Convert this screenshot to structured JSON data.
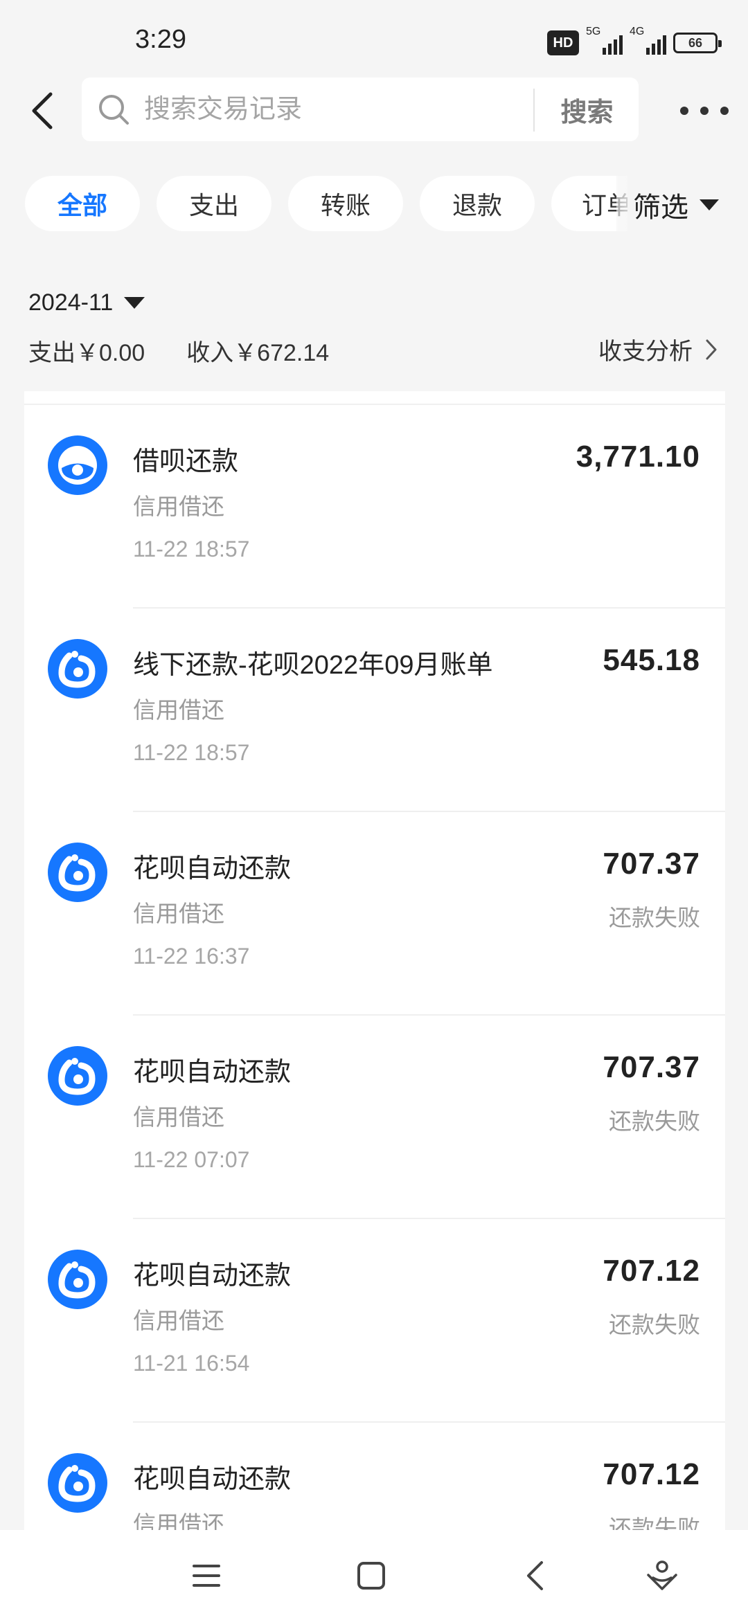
{
  "status_bar": {
    "time": "3:29",
    "hd": "HD",
    "net1": "5G",
    "net2": "4G",
    "battery": "66"
  },
  "header": {
    "search_placeholder": "搜索交易记录",
    "search_button": "搜索"
  },
  "filters": {
    "tabs": [
      "全部",
      "支出",
      "转账",
      "退款",
      "订单"
    ],
    "active_index": 0,
    "filter_label": "筛选"
  },
  "summary": {
    "month": "2024-11",
    "expense": "支出￥0.00",
    "income": "收入￥672.14",
    "analysis": "收支分析"
  },
  "transactions": [
    {
      "title": "借呗还款",
      "category": "信用借还",
      "time": "11-22 18:57",
      "amount": "3,771.10",
      "status": "",
      "icon": "jiebei-icon"
    },
    {
      "title": "线下还款-花呗2022年09月账单",
      "category": "信用借还",
      "time": "11-22 18:57",
      "amount": "545.18",
      "status": "",
      "icon": "huabei-icon"
    },
    {
      "title": "花呗自动还款",
      "category": "信用借还",
      "time": "11-22 16:37",
      "amount": "707.37",
      "status": "还款失败",
      "icon": "huabei-icon"
    },
    {
      "title": "花呗自动还款",
      "category": "信用借还",
      "time": "11-22 07:07",
      "amount": "707.37",
      "status": "还款失败",
      "icon": "huabei-icon"
    },
    {
      "title": "花呗自动还款",
      "category": "信用借还",
      "time": "11-21 16:54",
      "amount": "707.12",
      "status": "还款失败",
      "icon": "huabei-icon"
    },
    {
      "title": "花呗自动还款",
      "category": "信用借还",
      "time": "",
      "amount": "707.12",
      "status": "还款失败",
      "icon": "huabei-icon"
    }
  ],
  "colors": {
    "accent": "#1677ff",
    "background": "#f5f5f5",
    "icon_blue": "#1677ff"
  }
}
